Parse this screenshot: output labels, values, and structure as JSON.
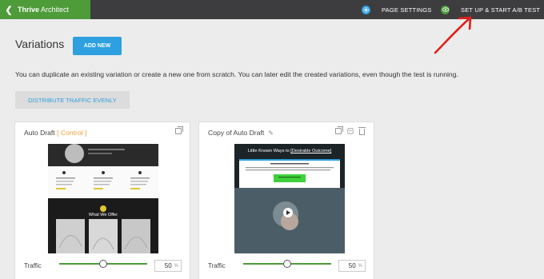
{
  "topbar": {
    "brand_strong": "Thrive",
    "brand_light": " Architect",
    "page_settings": "PAGE SETTINGS",
    "setup_test": "SET UP & START A/B TEST"
  },
  "main": {
    "title": "Variations",
    "add_new": "ADD NEW",
    "description": "You can duplicate an existing variation or create a new one from scratch. You can later edit the created variations, even though the test is running.",
    "distribute": "DISTRIBUTE TRAFFIC EVENLY"
  },
  "variations": [
    {
      "name": "Auto Draft",
      "control_label": "[ Control ]",
      "traffic_label": "Traffic",
      "traffic_value": "50",
      "traffic_unit": "%",
      "traffic_fraction": 0.5,
      "thumb_heading": "What We Offer"
    },
    {
      "name": "Copy of Auto Draft",
      "traffic_label": "Traffic",
      "traffic_value": "50",
      "traffic_unit": "%",
      "traffic_fraction": 0.5,
      "thumb_heading_prefix": "Little Known Ways to ",
      "thumb_heading_link": "[Desirable Outcome]"
    }
  ],
  "colors": {
    "brand_green": "#4e9b3a",
    "accent_blue": "#2ea0e0",
    "control_orange": "#f0a13a",
    "annotation_red": "#e0201a"
  },
  "icons": [
    "back-chevron-icon",
    "settings-icon",
    "eye-icon",
    "duplicate-icon",
    "pencil-icon",
    "reset-icon",
    "trash-icon",
    "play-icon"
  ]
}
